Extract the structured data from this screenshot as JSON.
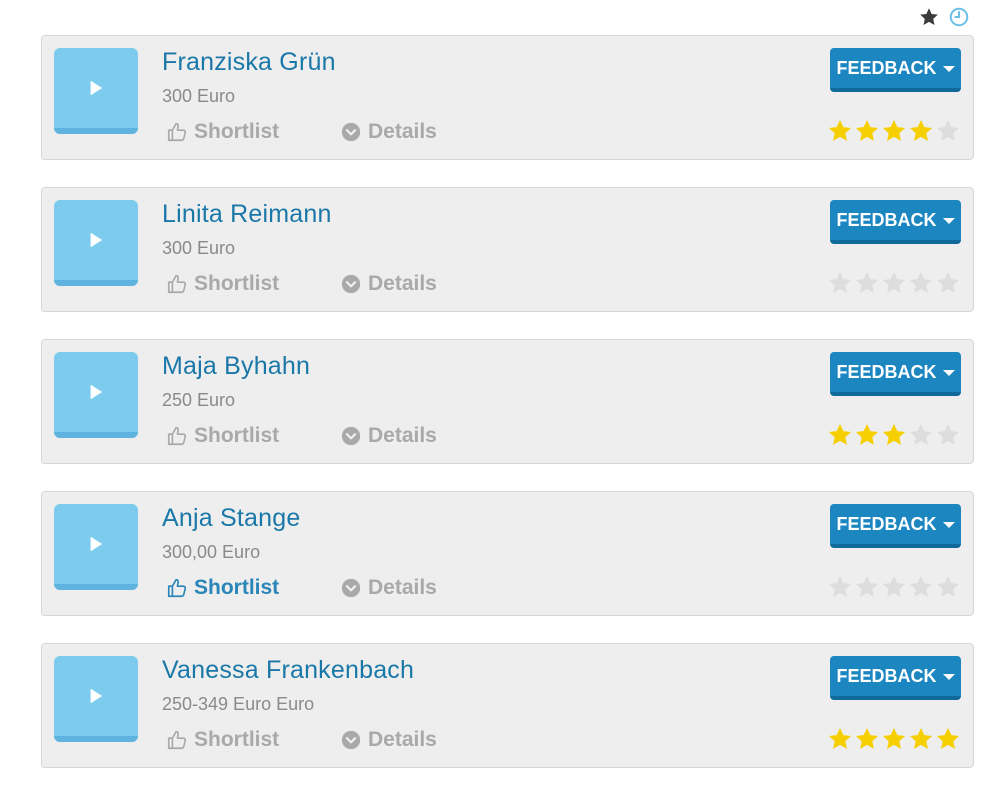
{
  "top_icons": [
    "star-icon",
    "clock-icon"
  ],
  "colors": {
    "name": "#1a78a8",
    "thumb": "#7dcbee",
    "button": "#1b86bf",
    "star_filled": "#f5cf00",
    "star_empty": "#dddddd",
    "action_inactive": "#a9a9a9",
    "action_active": "#2a86b8"
  },
  "cards": [
    {
      "name": "Franziska Grün",
      "price": "300 Euro",
      "shortlist_label": "Shortlist",
      "details_label": "Details",
      "feedback_label": "FEEDBACK",
      "rating": 4,
      "shortlisted": false
    },
    {
      "name": "Linita Reimann",
      "price": "300 Euro",
      "shortlist_label": "Shortlist",
      "details_label": "Details",
      "feedback_label": "FEEDBACK",
      "rating": 0,
      "shortlisted": false
    },
    {
      "name": "Maja Byhahn",
      "price": "250 Euro",
      "shortlist_label": "Shortlist",
      "details_label": "Details",
      "feedback_label": "FEEDBACK",
      "rating": 3,
      "shortlisted": false
    },
    {
      "name": "Anja Stange",
      "price": "300,00 Euro",
      "shortlist_label": "Shortlist",
      "details_label": "Details",
      "feedback_label": "FEEDBACK",
      "rating": 0,
      "shortlisted": true
    },
    {
      "name": "Vanessa Frankenbach",
      "price": "250-349 Euro Euro",
      "shortlist_label": "Shortlist",
      "details_label": "Details",
      "feedback_label": "FEEDBACK",
      "rating": 5,
      "shortlisted": false
    }
  ]
}
